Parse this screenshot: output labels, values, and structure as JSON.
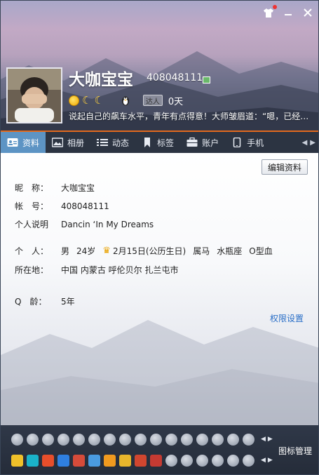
{
  "window": {
    "skin_icon": "tshirt-icon",
    "minimize_icon": "minimize-icon",
    "close_icon": "close-icon"
  },
  "profile": {
    "nickname": "大咖宝宝",
    "qq_number": "408048111",
    "daren_label": "达人",
    "daren_days": "0天",
    "signature": "说起自己的飙车水平，青年有点得意！大师皱眉道：“嗯，已经…"
  },
  "tabs": [
    {
      "label": "资料",
      "icon": "profile-card-icon",
      "active": true
    },
    {
      "label": "相册",
      "icon": "photo-album-icon",
      "active": false
    },
    {
      "label": "动态",
      "icon": "list-feed-icon",
      "active": false
    },
    {
      "label": "标签",
      "icon": "bookmark-icon",
      "active": false
    },
    {
      "label": "账户",
      "icon": "wallet-icon",
      "active": false
    },
    {
      "label": "手机",
      "icon": "mobile-phone-icon",
      "active": false
    }
  ],
  "content": {
    "edit_button": "编辑资料",
    "nickname_label": "昵　称：",
    "nickname_value": "大咖宝宝",
    "account_label": "帐　号：",
    "account_value": "408048111",
    "bio_label": "个人说明",
    "bio_value": "Dancin ‘In My Dreams",
    "personal_label": "个　人：",
    "gender": "男",
    "age": "24岁",
    "birthday": "2月15日(公历生日)",
    "zodiac": "属马",
    "constellation": "水瓶座",
    "blood": "O型血",
    "location_label": "所在地：",
    "location_value": "中国 内蒙古 呼伦贝尔 扎兰屯市",
    "qage_label": "Q　龄：",
    "qage_value": "5年",
    "permission_link": "权限设置"
  },
  "bottom_bar": {
    "manage_label": "图标管理"
  },
  "colors": {
    "accent_orange": "#e36a1d",
    "active_tab": "#5d94c4",
    "link_blue": "#2a6fc7",
    "dark_bar": "#2c3442"
  }
}
